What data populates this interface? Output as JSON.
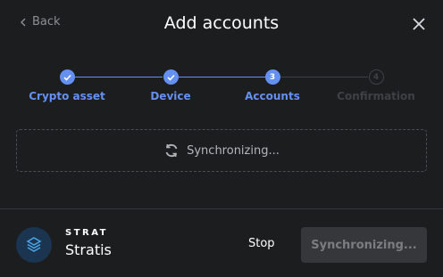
{
  "header": {
    "back_label": "Back",
    "title": "Add accounts"
  },
  "stepper": {
    "steps": [
      {
        "label": "Crypto asset",
        "state": "done",
        "mark": ""
      },
      {
        "label": "Device",
        "state": "done",
        "mark": ""
      },
      {
        "label": "Accounts",
        "state": "active",
        "mark": "3"
      },
      {
        "label": "Confirmation",
        "state": "pending",
        "mark": "4"
      }
    ]
  },
  "sync": {
    "status": "Synchronizing..."
  },
  "footer": {
    "coin_ticker": "STRAT",
    "coin_name": "Stratis",
    "stop_label": "Stop",
    "primary_label": "Synchronizing..."
  },
  "colors": {
    "accent": "#6490f1",
    "background": "#1c1d1f",
    "pending": "#3e4045"
  }
}
